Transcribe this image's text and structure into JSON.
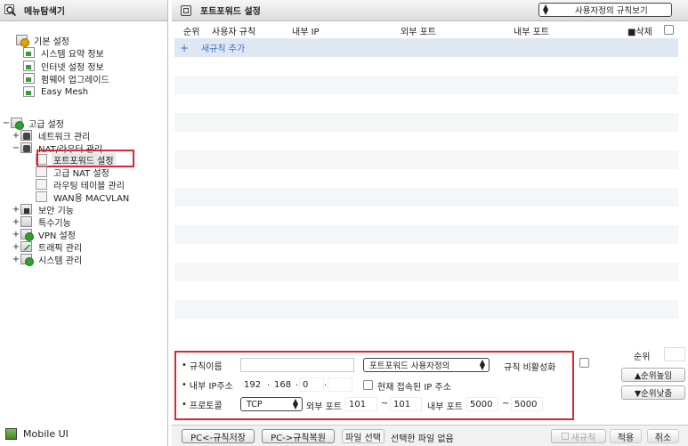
{
  "sidebar": {
    "title": "메뉴탐색기",
    "basic": {
      "label": "기본 설정",
      "items": [
        "시스템 요약 정보",
        "인터넷 설정 정보",
        "펌웨어 업그레이드",
        "Easy Mesh"
      ]
    },
    "advanced": {
      "label": "고급 설정",
      "network": "네트워크 관리",
      "nat": {
        "label": "NAT/라우터 관리",
        "items": [
          "포트포워드 설정",
          "고급 NAT 설정",
          "라우팅 테이블 관리",
          "WAN용 MACVLAN"
        ]
      },
      "others": [
        "보안 기능",
        "특수기능",
        "VPN 설정",
        "트래픽 관리",
        "시스템 관리"
      ]
    },
    "footer": "Mobile UI",
    "toggle_plus": "+",
    "toggle_minus": "−"
  },
  "main": {
    "title": "포트포워드 설정",
    "view_select": "사용자정의 규칙보기",
    "table": {
      "headers": {
        "order": "순위",
        "rule": "사용자 규칙",
        "internal_ip": "내부 IP",
        "external_port": "외부 포트",
        "internal_port": "내부 포트",
        "delete": "■삭제"
      },
      "add_icon": "+",
      "add_label": "새규칙 추가"
    },
    "form": {
      "rule_name_label": "규칙이름",
      "rule_name_value": "",
      "rule_type_select": "포트포워드 사용자정의",
      "disable_label": "규칙 비활성화",
      "ip_label": "내부 IP주소",
      "ip_octets": [
        "192",
        "168",
        "0",
        ""
      ],
      "ip_dots": [
        ".",
        ".",
        "."
      ],
      "current_ip_label": "현재 접속된 IP 주소",
      "protocol_label": "프로토콜",
      "protocol_value": "TCP",
      "external_port_label": "외부 포트",
      "external_port_from": "101",
      "external_port_to": "101",
      "internal_port_label": "내부 포트",
      "internal_port_from": "5000",
      "internal_port_to": "5000",
      "tilde": "~",
      "bullet": "•"
    },
    "order_panel": {
      "label": "순위",
      "up": "▲순위높임",
      "down": "▼순위낮춤"
    },
    "bottom": {
      "save_pc": "PC<-규칙저장",
      "restore_pc": "PC->규칙복원",
      "file_select": "파일 선택",
      "file_status": "선택한 파일 없음",
      "new_rule": "새규칙",
      "apply": "적용",
      "cancel": "취소"
    }
  }
}
